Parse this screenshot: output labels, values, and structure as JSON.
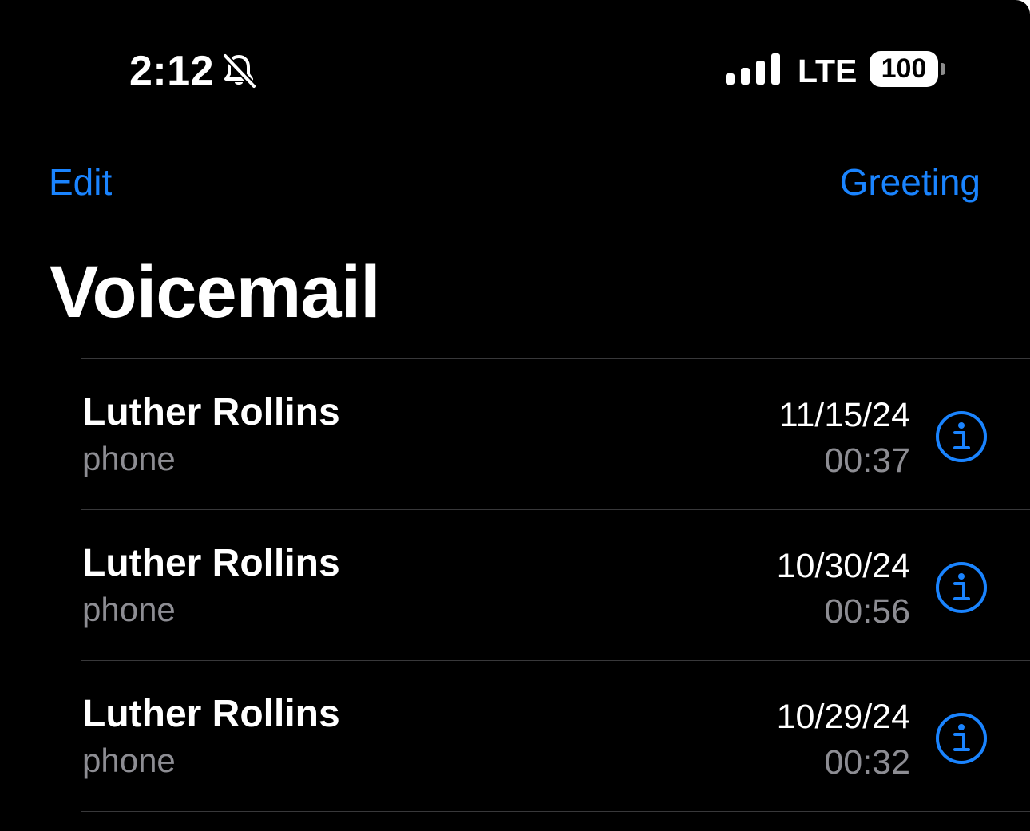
{
  "status_bar": {
    "time": "2:12",
    "bell_icon": "bell-slash-icon",
    "signal_icon": "cellular-signal-icon",
    "network": "LTE",
    "battery": "100"
  },
  "nav": {
    "left_label": "Edit",
    "right_label": "Greeting"
  },
  "page_title": "Voicemail",
  "colors": {
    "accent": "#1a84ff",
    "background": "#000000",
    "secondary_text": "#8d8d93",
    "separator": "#38383a"
  },
  "voicemails": [
    {
      "name": "Luther Rollins",
      "label": "phone",
      "date": "11/15/24",
      "duration": "00:37",
      "icon": "info-icon"
    },
    {
      "name": "Luther Rollins",
      "label": "phone",
      "date": "10/30/24",
      "duration": "00:56",
      "icon": "info-icon"
    },
    {
      "name": "Luther Rollins",
      "label": "phone",
      "date": "10/29/24",
      "duration": "00:32",
      "icon": "info-icon"
    }
  ]
}
